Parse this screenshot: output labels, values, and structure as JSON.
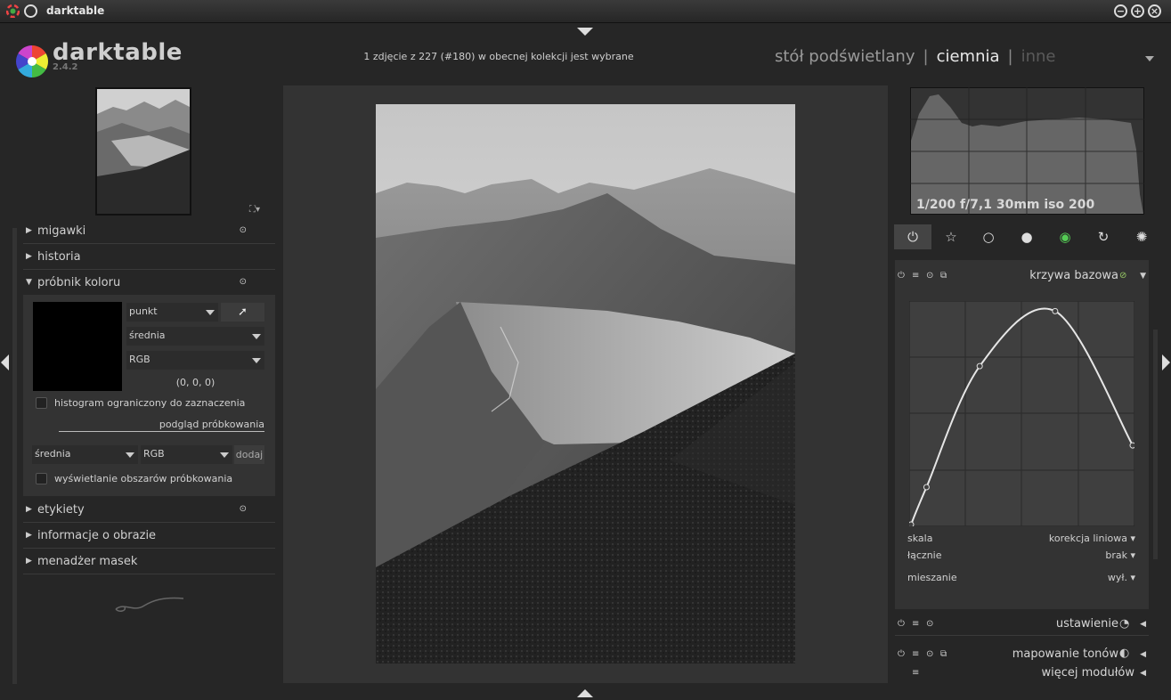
{
  "window": {
    "title": "darktable"
  },
  "header": {
    "app_name": "darktable",
    "version": "2.4.2",
    "status": "1 zdjęcie z 227 (#180) w obecnej kolekcji jest wybrane",
    "views": {
      "lighttable": "stół podświetlany",
      "darkroom": "ciemnia",
      "other": "inne",
      "sep": "|"
    }
  },
  "left": {
    "sections": {
      "snapshots": "migawki",
      "history": "historia",
      "color_picker": "próbnik koloru",
      "tagging": "etykiety",
      "image_info": "informacje o obrazie",
      "mask_manager": "menadżer masek"
    },
    "color_picker": {
      "mode": "punkt",
      "stat": "średnia",
      "colorspace": "RGB",
      "value": "(0, 0, 0)",
      "histogram_restrict": "histogram ograniczony do zaznaczenia",
      "live_samples": "podgląd próbkowania",
      "sample_stat": "średnia",
      "sample_colorspace": "RGB",
      "add_label": "dodaj",
      "display_areas": "wyświetlanie obszarów próbkowania",
      "swatch_color": "#000000"
    }
  },
  "right": {
    "exif": "1/200 f/7,1 30mm iso 200",
    "groups": [
      "power-icon",
      "star-icon",
      "circle-icon",
      "sphere-icon",
      "color-wheel-icon",
      "correct-icon",
      "effect-icon"
    ],
    "modules": {
      "base_curve": "krzywa bazowa",
      "exposure": "ustawienie",
      "tone_mapping": "mapowanie tonów",
      "more": "więcej modułów"
    },
    "base_curve": {
      "scale_label": "skala",
      "scale_value": "korekcja liniowa",
      "fusion_label": "łącznie",
      "fusion_value": "brak",
      "blend_label": "mieszanie",
      "blend_value": "wył.",
      "points": [
        [
          0,
          0
        ],
        [
          0.07,
          0.17
        ],
        [
          0.31,
          0.72
        ],
        [
          0.65,
          0.97
        ],
        [
          1,
          0.36
        ]
      ]
    }
  }
}
